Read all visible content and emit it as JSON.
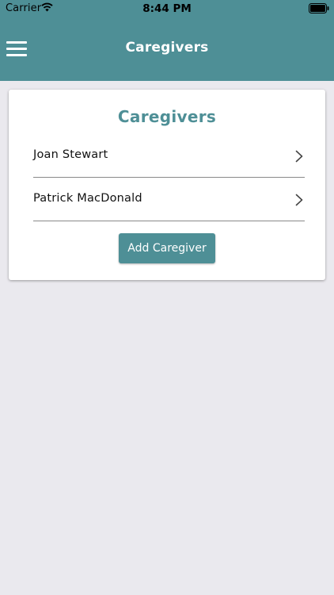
{
  "status_bar": {
    "carrier": "Carrier",
    "time": "8:44 PM"
  },
  "header": {
    "title": "Caregivers",
    "menu_icon": "hamburger-menu-icon"
  },
  "card": {
    "title": "Caregivers",
    "caregivers": [
      {
        "name": "Joan Stewart"
      },
      {
        "name": "Patrick MacDonald"
      }
    ],
    "add_button_label": "Add Caregiver"
  },
  "colors": {
    "accent": "#4e8f96",
    "background": "#eae9ee"
  }
}
